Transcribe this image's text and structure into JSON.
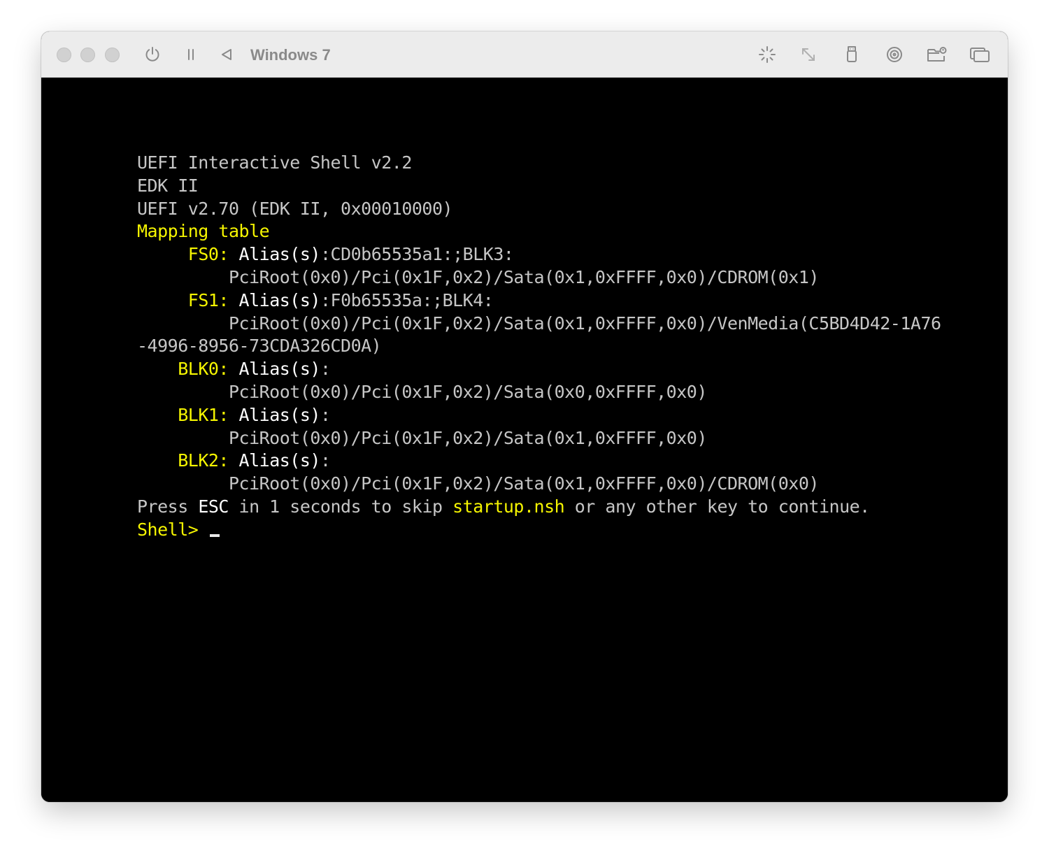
{
  "window": {
    "title": "Windows 7"
  },
  "toolbar": {
    "left_icons": [
      "power-icon",
      "pause-icon",
      "back-icon"
    ],
    "right_icons": [
      "brightness-icon",
      "resize-icon",
      "usb-icon",
      "cd-icon",
      "shared-folder-icon",
      "windows-icon"
    ]
  },
  "colors": {
    "accent_yellow": "#f5f500",
    "text_gray": "#c6c6c6",
    "text_white": "#ffffff",
    "screen_bg": "#000000",
    "titlebar_bg": "#ececec"
  },
  "terminal": {
    "header": {
      "line1": "UEFI Interactive Shell v2.2",
      "line2": "EDK II",
      "line3": "UEFI v2.70 (EDK II, 0x00010000)"
    },
    "mapping_title": "Mapping table",
    "entries": [
      {
        "name": "FS0:",
        "alias_label": "Alias(s)",
        "alias_value": ":CD0b65535a1:;BLK3:",
        "path": "PciRoot(0x0)/Pci(0x1F,0x2)/Sata(0x1,0xFFFF,0x0)/CDROM(0x1)"
      },
      {
        "name": "FS1:",
        "alias_label": "Alias(s)",
        "alias_value": ":F0b65535a:;BLK4:",
        "path": "PciRoot(0x0)/Pci(0x1F,0x2)/Sata(0x1,0xFFFF,0x0)/VenMedia(C5BD4D42-1A76",
        "path_cont": "-4996-8956-73CDA326CD0A)"
      },
      {
        "name": "BLK0:",
        "alias_label": "Alias(s)",
        "alias_value": ":",
        "path": "PciRoot(0x0)/Pci(0x1F,0x2)/Sata(0x0,0xFFFF,0x0)"
      },
      {
        "name": "BLK1:",
        "alias_label": "Alias(s)",
        "alias_value": ":",
        "path": "PciRoot(0x0)/Pci(0x1F,0x2)/Sata(0x1,0xFFFF,0x0)"
      },
      {
        "name": "BLK2:",
        "alias_label": "Alias(s)",
        "alias_value": ":",
        "path": "PciRoot(0x0)/Pci(0x1F,0x2)/Sata(0x1,0xFFFF,0x0)/CDROM(0x0)"
      }
    ],
    "press": {
      "part1": "Press ",
      "esc": "ESC",
      "part2": " in 1 seconds to skip ",
      "script": "startup.nsh",
      "part3": " or any other key to continue."
    },
    "prompt": "Shell> "
  }
}
